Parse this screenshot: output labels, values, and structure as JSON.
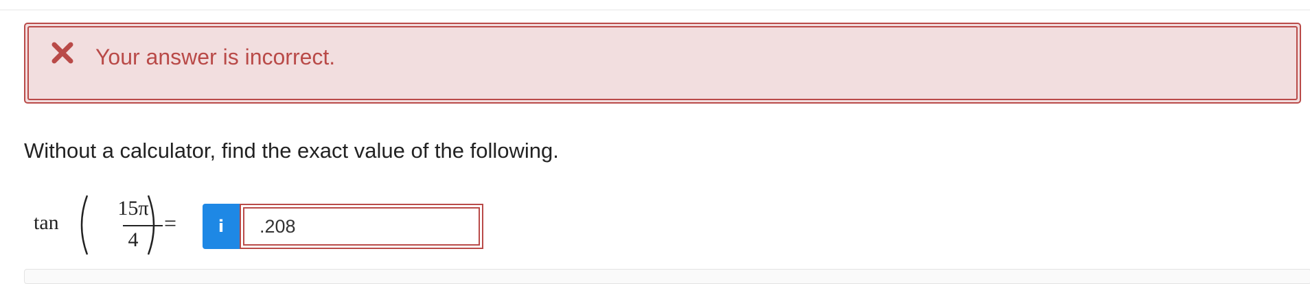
{
  "feedback": {
    "icon": "close-x-icon",
    "message": "Your answer is incorrect.",
    "color": "#b94a48",
    "background": "#f2dedf"
  },
  "question": {
    "prompt": "Without a calculator, find the exact value of the following.",
    "function": "tan",
    "numerator": "15π",
    "denominator": "4",
    "equals": "="
  },
  "answer": {
    "info_icon": "info-icon",
    "info_label": "i",
    "value": ".208",
    "accent": "#1e88e5"
  }
}
